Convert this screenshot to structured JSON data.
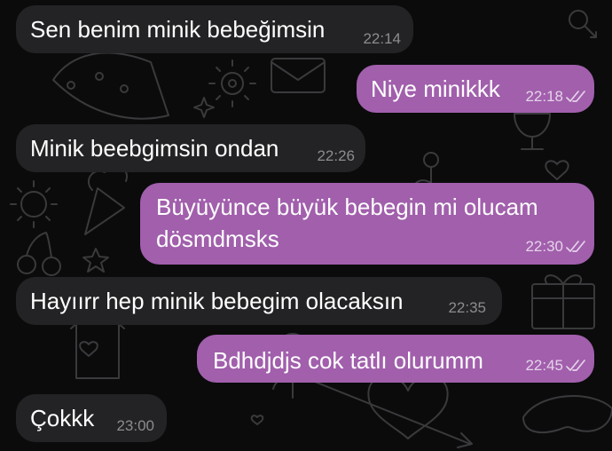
{
  "messages": [
    {
      "direction": "incoming",
      "text": "Sen benim minik bebeğimsin",
      "time": "22:14"
    },
    {
      "direction": "outgoing",
      "text": "Niye minikkk",
      "time": "22:18",
      "status": "read"
    },
    {
      "direction": "incoming",
      "text": "Minik beebgimsin ondan",
      "time": "22:26"
    },
    {
      "direction": "outgoing",
      "lines": [
        "Büyüyünce büyük bebegin mi olucam",
        "dösmdmsks"
      ],
      "time": "22:30",
      "status": "read"
    },
    {
      "direction": "incoming",
      "text": "Hayıırr hep minik bebegim olacaksın",
      "time": "22:35"
    },
    {
      "direction": "outgoing",
      "text": "Bdhdjdjs cok tatlı olurumm",
      "time": "22:45",
      "status": "read"
    },
    {
      "direction": "incoming",
      "text": "Çokkk",
      "time": "23:00"
    }
  ],
  "colors": {
    "background": "#0b0b0c",
    "incoming_bubble": "#232325",
    "outgoing_bubble": "#a15fac",
    "text": "#ffffff",
    "wallpaper_doodle": "#3a3a3d"
  },
  "icons": {
    "read_receipt": "double-check-icon"
  }
}
